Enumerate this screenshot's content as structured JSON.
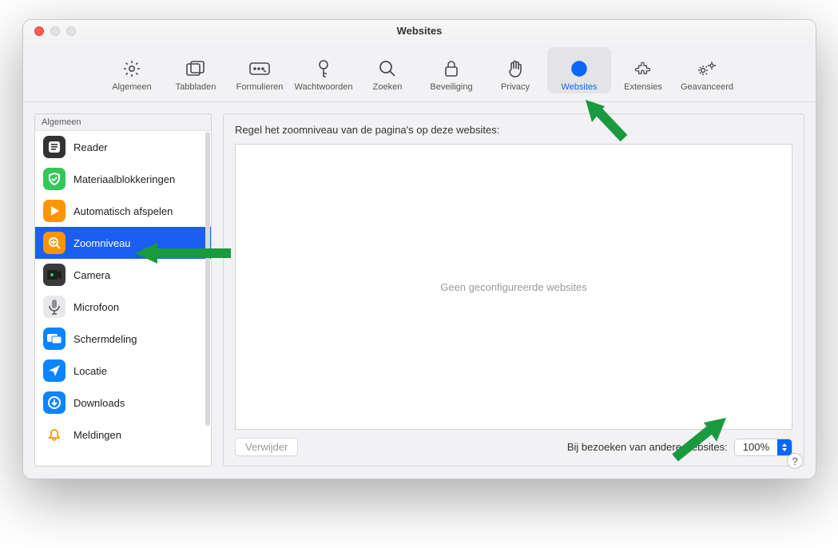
{
  "window": {
    "title": "Websites"
  },
  "toolbar": [
    {
      "id": "general",
      "label": "Algemeen",
      "icon": "gear"
    },
    {
      "id": "tabs",
      "label": "Tabbladen",
      "icon": "tabs"
    },
    {
      "id": "forms",
      "label": "Formulieren",
      "icon": "form"
    },
    {
      "id": "passwords",
      "label": "Wachtwoorden",
      "icon": "key"
    },
    {
      "id": "search",
      "label": "Zoeken",
      "icon": "search"
    },
    {
      "id": "security",
      "label": "Beveiliging",
      "icon": "lock"
    },
    {
      "id": "privacy",
      "label": "Privacy",
      "icon": "hand"
    },
    {
      "id": "websites",
      "label": "Websites",
      "icon": "globe",
      "selected": true
    },
    {
      "id": "extensions",
      "label": "Extensies",
      "icon": "puzzle"
    },
    {
      "id": "advanced",
      "label": "Geavanceerd",
      "icon": "gears"
    }
  ],
  "sidebar": {
    "header": "Algemeen",
    "items": [
      {
        "id": "reader",
        "label": "Reader",
        "icon": "reader",
        "bg": "#333333",
        "fg": "#ffffff"
      },
      {
        "id": "blockers",
        "label": "Materiaalblokkeringen",
        "icon": "shield",
        "bg": "#34c759",
        "fg": "#ffffff"
      },
      {
        "id": "autoplay",
        "label": "Automatisch afspelen",
        "icon": "play",
        "bg": "#ff9500",
        "fg": "#ffffff"
      },
      {
        "id": "zoom",
        "label": "Zoomniveau",
        "icon": "zoom",
        "bg": "#ff9500",
        "fg": "#ffffff",
        "selected": true
      },
      {
        "id": "camera",
        "label": "Camera",
        "icon": "camera",
        "bg": "#3a3a3c",
        "fg": "#ffffff"
      },
      {
        "id": "microphone",
        "label": "Microfoon",
        "icon": "mic",
        "bg": "#e9e9eb",
        "fg": "#5a5a5c"
      },
      {
        "id": "screenshare",
        "label": "Schermdeling",
        "icon": "screens",
        "bg": "#0a84ff",
        "fg": "#ffffff"
      },
      {
        "id": "location",
        "label": "Locatie",
        "icon": "location",
        "bg": "#0a84ff",
        "fg": "#ffffff"
      },
      {
        "id": "downloads",
        "label": "Downloads",
        "icon": "download",
        "bg": "#0a84ff",
        "fg": "#ffffff"
      },
      {
        "id": "notifications",
        "label": "Meldingen",
        "icon": "bell",
        "bg": "#ffffff",
        "fg": "#ff9500"
      }
    ]
  },
  "main": {
    "instruction": "Regel het zoomniveau van de pagina's op deze websites:",
    "empty_state": "Geen geconfigureerde websites",
    "delete_button": "Verwijder",
    "other_sites_label": "Bij bezoeken van andere websites:",
    "zoom_value": "100%"
  },
  "help": "?"
}
